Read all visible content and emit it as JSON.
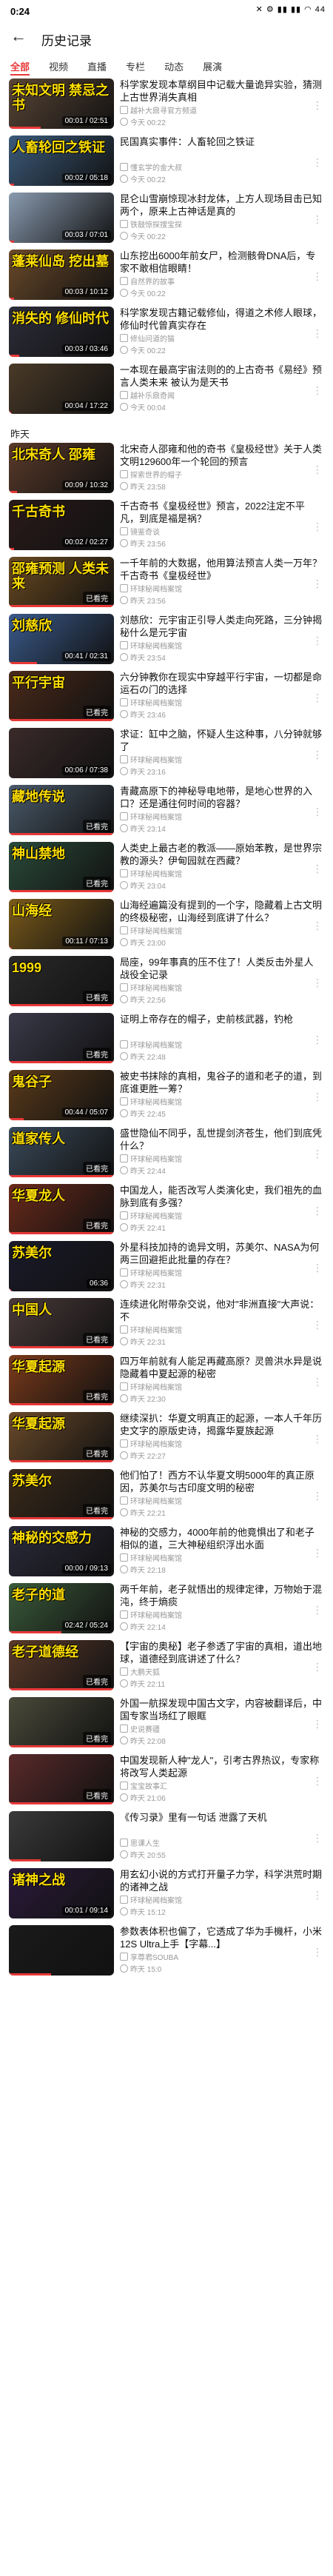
{
  "status": {
    "time": "0:24",
    "icons": "✕ ⚙ ▮▮ ▮▮ ◠ 44"
  },
  "header": {
    "title": "历史记录",
    "back": "←"
  },
  "tabs": [
    "全部",
    "视频",
    "直播",
    "专栏",
    "动态",
    "展演"
  ],
  "sections": [
    {
      "label": "",
      "items": [
        {
          "title": "科学家发现本草纲目中记载大量诡异实验，猜测上古世界消失真相",
          "meta": "越补大鼎寻官方频道",
          "when": "今天 00:22",
          "badge": "00:01 / 02:51",
          "thumb": "未知文明 禁忌之书",
          "color": "#5a4636",
          "progress": 0.3
        },
        {
          "title": "民国真实事件：人畜轮回之铁证",
          "meta": "懂玄学的金大叔",
          "when": "今天 00:22",
          "badge": "00:02 / 05:18",
          "thumb": "人畜轮回之铁证",
          "color": "#3b5a7a",
          "progress": 0.05
        },
        {
          "title": "昆仑山雪崩惊现冰封龙体，上方人现场目击已知两个，原来上古神话是真的",
          "meta": "铁鼓惊探搜宝探",
          "when": "今天 00:22",
          "badge": "00:03 / 07:01",
          "thumb": "",
          "color": "#8a9bb0",
          "progress": 0.05
        },
        {
          "title": "山东挖出6000年前女尸，检测骸骨DNA后，专家不敢相信眼睛！",
          "meta": "自然界的故事",
          "when": "今天 00:22",
          "badge": "00:03 / 10:12",
          "thumb": "蓬莱仙岛 挖出墓",
          "color": "#6b4a2a",
          "progress": 0.05
        },
        {
          "title": "科学家发现古籍记载修仙，得道之术修人眼球，修仙时代曾真实存在",
          "meta": "修仙问道的猫",
          "when": "今天 00:22",
          "badge": "00:03 / 03:46",
          "thumb": "消失的 修仙时代",
          "color": "#2d2d3a",
          "progress": 0.1
        },
        {
          "title": "一本现在最高宇宙法则的的上古奇书《易经》预言人类未来 被认为是天书",
          "meta": "越补乐鼎奇闻",
          "when": "今天 00:04",
          "badge": "00:04 / 17:22",
          "thumb": "",
          "color": "#4a3a28",
          "progress": 0.02
        }
      ]
    },
    {
      "label": "昨天",
      "items": [
        {
          "title": "北宋奇人邵雍和他的奇书《皇极经世》关于人类文明129600年一个轮回的预言",
          "meta": "探索世界的帽子",
          "when": "昨天 23:58",
          "badge": "00:09 / 10:32",
          "thumb": "北宋奇人 邵雍",
          "color": "#5a3a2a",
          "progress": 0.08
        },
        {
          "title": "千古奇书《皇极经世》预言，2022注定不平凡，到底是福是祸？",
          "meta": "镜鉴奇谈",
          "when": "昨天 23:56",
          "badge": "00:02 / 02:27",
          "thumb": "千古奇书",
          "color": "#2a1a1a",
          "progress": 0.05
        },
        {
          "title": "一千年前的大数据，他用算法预言人类一万年？千古奇书《皇极经世》",
          "meta": "环球秘闻档案馆",
          "when": "昨天 23:56",
          "badge": "已看完",
          "thumb": "邵雍预测 人类未来",
          "color": "#6a4a20",
          "progress": 1
        },
        {
          "title": "刘慈欣：元宇宙正引导人类走向死路，三分钟揭秘什么是元宇宙",
          "meta": "环球秘闻档案馆",
          "when": "昨天 23:54",
          "badge": "00:41 / 02:31",
          "thumb": "刘慈欣",
          "color": "#3a5a8a",
          "progress": 0.27
        },
        {
          "title": "六分钟教你在现实中穿越平行宇宙，一切都是命运石の门的选择",
          "meta": "环球秘闻档案馆",
          "when": "昨天 23:46",
          "badge": "已看完",
          "thumb": "平行宇宙",
          "color": "#4a2a1a",
          "progress": 1
        },
        {
          "title": "求证：缸中之脑，怀疑人生这种事，八分钟就够了",
          "meta": "环球秘闻档案馆",
          "when": "昨天 23:16",
          "badge": "00:06 / 07:38",
          "thumb": "",
          "color": "#3a2a2a",
          "progress": 0.01
        },
        {
          "title": "青藏高原下的神秘导电地带，是地心世界的入口？还是通往何时间的容器？",
          "meta": "环球秘闻档案馆",
          "when": "昨天 23:14",
          "badge": "已看完",
          "thumb": "藏地传说",
          "color": "#4a5a6a",
          "progress": 1
        },
        {
          "title": "人类史上最古老的教派——原始苯教，是世界宗教的源头？伊甸园就在西藏？",
          "meta": "环球秘闻档案馆",
          "when": "昨天 23:04",
          "badge": "已看完",
          "thumb": "神山禁地",
          "color": "#2a4a3a",
          "progress": 1
        },
        {
          "title": "山海经遍篇没有提到的一个字，隐藏着上古文明的终极秘密，山海经到底讲了什么？",
          "meta": "环球秘闻档案馆",
          "when": "昨天 23:00",
          "badge": "00:11 / 07:13",
          "thumb": "山海经",
          "color": "#7a5a1a",
          "progress": 0.02
        },
        {
          "title": "局座，99年事真的压不住了！人类反击外星人战役全记录",
          "meta": "环球秘闻档案馆",
          "when": "昨天 22:56",
          "badge": "已看完",
          "thumb": "1999",
          "color": "#2a2a2a",
          "progress": 1
        },
        {
          "title": "证明上帝存在的帽子，史前核武器，钓枪",
          "meta": "环球秘闻档案馆",
          "when": "昨天 22:48",
          "badge": "已看完",
          "thumb": "",
          "color": "#3a3a4a",
          "progress": 1
        },
        {
          "title": "被史书抹除的真相，鬼谷子的道和老子的道，到底谁更胜一筹？",
          "meta": "环球秘闻档案馆",
          "when": "昨天 22:45",
          "badge": "00:44 / 05:07",
          "thumb": "鬼谷子",
          "color": "#5a3a1a",
          "progress": 0.14
        },
        {
          "title": "盛世隐仙不同乎，乱世提剑济苍生，他们到底凭什么？",
          "meta": "环球秘闻档案馆",
          "when": "昨天 22:44",
          "badge": "已看完",
          "thumb": "道家传人",
          "color": "#3a4a5a",
          "progress": 1
        },
        {
          "title": "中国龙人，能否改写人类演化史，我们祖先的血脉到底有多强？",
          "meta": "环球秘闻档案馆",
          "when": "昨天 22:41",
          "badge": "已看完",
          "thumb": "华夏龙人",
          "color": "#6a2a1a",
          "progress": 1
        },
        {
          "title": "外星科技加持的诡异文明，苏美尔、NASA为何两三回避拒此批量的存在？",
          "meta": "环球秘闻档案馆",
          "when": "昨天 22:31",
          "badge": "06:36",
          "thumb": "苏美尔",
          "color": "#1a1a2a",
          "progress": 0.02
        },
        {
          "title": "连续进化附带杂交说，他对\"非洲直接\"大声说：不",
          "meta": "环球秘闻档案馆",
          "when": "昨天 22:31",
          "badge": "已看完",
          "thumb": "中国人",
          "color": "#4a3a3a",
          "progress": 1
        },
        {
          "title": "四万年前就有人能足再藏高原？灵兽洪水异是说隐藏着中夏起源的秘密",
          "meta": "环球秘闻档案馆",
          "when": "昨天 22:30",
          "badge": "已看完",
          "thumb": "华夏起源",
          "color": "#7a3a1a",
          "progress": 1
        },
        {
          "title": "继续深扒：华夏文明真正的起源，一本人千年历史文字的原版史诗，揭露华夏族起源",
          "meta": "环球秘闻档案馆",
          "when": "昨天 22:27",
          "badge": "已看完",
          "thumb": "华夏起源",
          "color": "#6a4a2a",
          "progress": 1
        },
        {
          "title": "他们怕了！西方不认华夏文明5000年的真正原因，苏美尔与古印度文明的秘密",
          "meta": "环球秘闻档案馆",
          "when": "昨天 22:21",
          "badge": "已看完",
          "thumb": "苏美尔",
          "color": "#3a2a1a",
          "progress": 1
        },
        {
          "title": "神秘的交感力，4000年前的他竟惧出了和老子相似的道，三大神秘组织浮出水面",
          "meta": "环球秘闻档案馆",
          "when": "昨天 22:18",
          "badge": "00:00 / 09:13",
          "thumb": "神秘的交感力",
          "color": "#2a2a3a",
          "progress": 0.01
        },
        {
          "title": "两千年前，老子就悟出的规律定律，万物始于混沌，终于熵痰",
          "meta": "环球秘闻档案馆",
          "when": "昨天 22:14",
          "badge": "02:42 / 05:24",
          "thumb": "老子的道",
          "color": "#3a5a3a",
          "progress": 0.5
        },
        {
          "title": "【宇宙的奥秘】老子参透了宇宙的真相，道出地球，道德经到底讲述了什么？",
          "meta": "大鹏天狐",
          "when": "昨天 22:11",
          "badge": "已看完",
          "thumb": "老子道德经",
          "color": "#5a3a2a",
          "progress": 1
        },
        {
          "title": "外国一航探发现中国古文字，内容被翻译后，中国专家当场红了眼眶",
          "meta": "史说赛疆",
          "when": "昨天 22:08",
          "badge": "已看完",
          "thumb": "",
          "color": "#4a4a3a",
          "progress": 1
        },
        {
          "title": "中国发现新人种\"龙人\"，引考古界热议，专家称将改写人类起源",
          "meta": "宝宝故事汇",
          "when": "昨天 21:06",
          "badge": "已看完",
          "thumb": "",
          "color": "#5a2a2a",
          "progress": 1
        },
        {
          "title": "《传习录》里有一句话 泄露了天机",
          "meta": "思课人生",
          "when": "昨天 20:55",
          "badge": "",
          "thumb": "",
          "color": "#3a3a3a",
          "progress": 0.3
        },
        {
          "title": "用玄幻小说的方式打开量子力学，科学洪荒时期的诸神之战",
          "meta": "环球秘闻档案馆",
          "when": "昨天 15:12",
          "badge": "00:01 / 09:14",
          "thumb": "诸神之战",
          "color": "#2a1a3a",
          "progress": 0.01
        },
        {
          "title": "参数表体积也偏了，它透成了华为手機杆，小米12S Ultra上手【字幕...】",
          "meta": "享尊君SOUBA",
          "when": "昨天 15:0",
          "badge": "",
          "thumb": "",
          "color": "#1a1a1a",
          "progress": 0.4
        }
      ]
    }
  ]
}
